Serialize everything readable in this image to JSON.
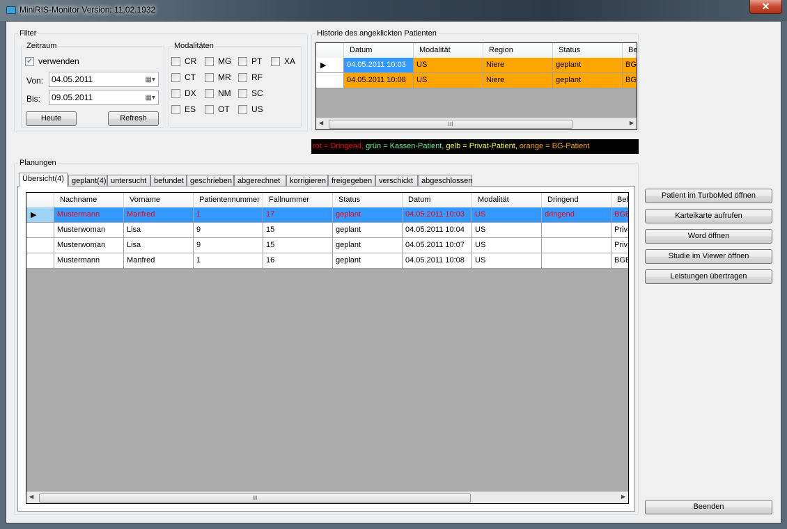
{
  "window": {
    "title": "MiniRIS-Monitor Version: 11.02.1932",
    "close_icon": "close-icon"
  },
  "filter": {
    "label": "Filter",
    "zeitraum": {
      "label": "Zeitraum",
      "use_label": "verwenden",
      "use_checked": true,
      "von_label": "Von:",
      "von_value": "04.05.2011",
      "bis_label": "Bis:",
      "bis_value": "09.05.2011",
      "today_button": "Heute",
      "refresh_button": "Refresh"
    },
    "modalities": {
      "label": "Modalitäten",
      "items": [
        "CR",
        "MG",
        "PT",
        "XA",
        "CT",
        "MR",
        "RF",
        "DX",
        "NM",
        "SC",
        "ES",
        "OT",
        "US"
      ]
    }
  },
  "history": {
    "label": "Historie des angeklickten Patienten",
    "columns": [
      "Datum",
      "Modalität",
      "Region",
      "Status",
      "Be"
    ],
    "rows": [
      [
        "04.05.2011 10:03",
        "US",
        "Niere",
        "geplant",
        "BG"
      ],
      [
        "04.05.2011 10:08",
        "US",
        "Niere",
        "geplant",
        "BG"
      ]
    ],
    "row_color": "#ffa500",
    "selected_color": "#3399ff"
  },
  "legend": {
    "parts": [
      {
        "text": "rot = Dringend, ",
        "color": "#ff0000"
      },
      {
        "text": "grün = Kassen-Patient, ",
        "color": "#66ee99"
      },
      {
        "text": "gelb = Privat-Patient, ",
        "color": "#ffff33"
      },
      {
        "text": "orange = BG-Patient",
        "color": "#ffa500"
      }
    ]
  },
  "planungen": {
    "label": "Planungen",
    "tabs": [
      "Übersicht(4)",
      "geplant(4)",
      "untersucht",
      "befundet",
      "geschrieben",
      "abgerechnet",
      "korrigieren",
      "freigegeben",
      "verschickt",
      "abgeschlossen"
    ],
    "active_tab": 0,
    "columns": [
      "Nachname",
      "Vorname",
      "Patientennummer",
      "Fallnummer",
      "Status",
      "Datum",
      "Modalität",
      "Dringend",
      "Beh"
    ],
    "rows": [
      [
        "Mustermann",
        "Manfred",
        "1",
        "17",
        "geplant",
        "04.05.2011 10:03",
        "US",
        "dringend",
        "BGB"
      ],
      [
        "Musterwoman",
        "Lisa",
        "9",
        "15",
        "geplant",
        "04.05.2011 10:04",
        "US",
        "",
        "Priva"
      ],
      [
        "Musterwoman",
        "Lisa",
        "9",
        "15",
        "geplant",
        "04.05.2011 10:07",
        "US",
        "",
        "Priva"
      ],
      [
        "Mustermann",
        "Manfred",
        "1",
        "16",
        "geplant",
        "04.05.2011 10:08",
        "US",
        "",
        "BGB"
      ]
    ],
    "selected_row": 0,
    "urgent_color": "#ff0000",
    "selected_color": "#3399ff"
  },
  "actions": {
    "buttons": [
      "Patient im TurboMed öffnen",
      "Karteikarte aufrufen",
      "Word öffnen",
      "Studie im Viewer öffnen",
      "Leistungen übertragen"
    ],
    "exit": "Beenden"
  }
}
